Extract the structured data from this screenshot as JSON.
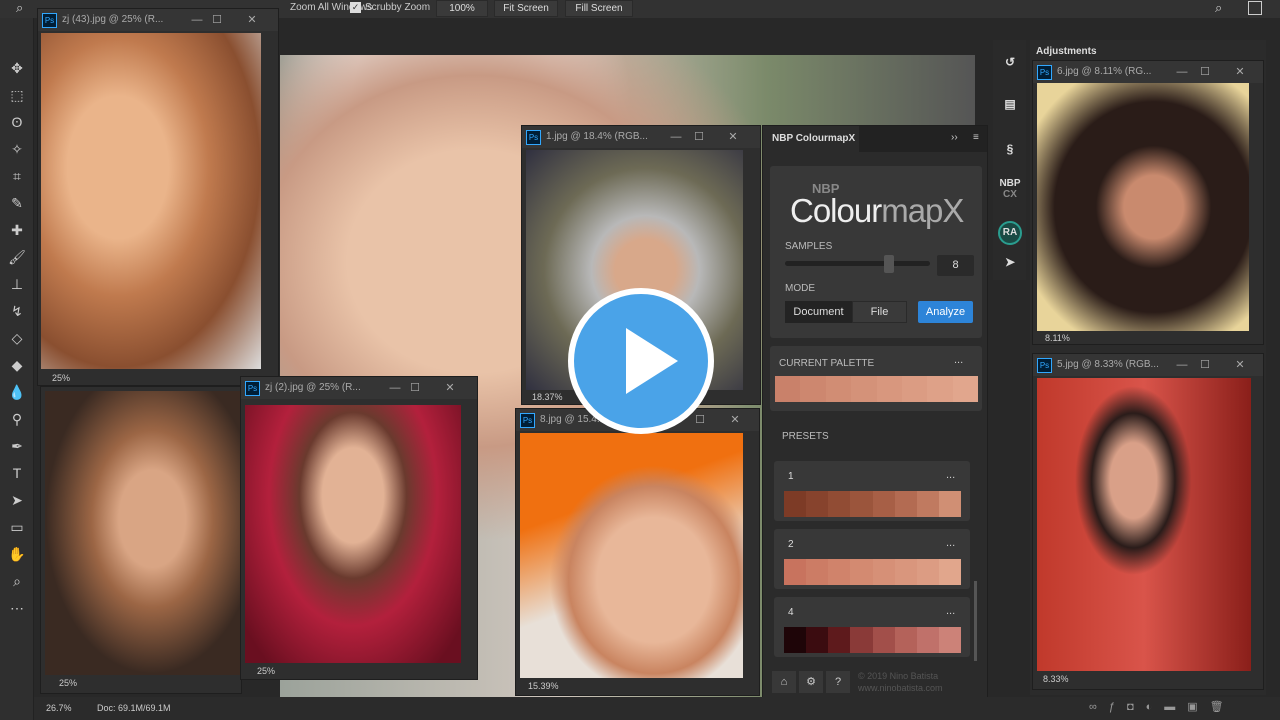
{
  "options_bar": {
    "zoom_all_windows": "Zoom All Windows",
    "scrubby_zoom": "Scrubby Zoom",
    "scrubby_checked": true,
    "btn_100": "100%",
    "fit_screen": "Fit Screen",
    "fill_screen": "Fill Screen"
  },
  "tools": [
    "move",
    "marquee",
    "lasso",
    "magic-wand",
    "crop",
    "eyedropper",
    "healing",
    "brush",
    "stamp",
    "history-brush",
    "eraser",
    "paint-bucket",
    "blur",
    "dodge",
    "pen",
    "type",
    "path-select",
    "rectangle",
    "hand",
    "zoom",
    "more"
  ],
  "windows": {
    "w1": {
      "title": "zj (43).jpg @ 25% (R...",
      "zoom": "25%"
    },
    "w2": {
      "zoom": "25%"
    },
    "w3": {
      "title": "zj (2).jpg @ 25% (R...",
      "zoom": "25%"
    },
    "w4": {
      "title": "1.jpg @ 18.4% (RGB...",
      "zoom": "18.37%"
    },
    "w5": {
      "title": "8.jpg @ 15.4...",
      "zoom": "15.39%"
    },
    "w6": {
      "title": "6.jpg @ 8.11% (RG...",
      "zoom": "8.11%"
    },
    "w7": {
      "title": "5.jpg @ 8.33% (RGB...",
      "zoom": "8.33%"
    }
  },
  "nbp": {
    "tab": "NBP ColourmapX",
    "logo_top": "NBP",
    "logo_main": "Colour",
    "logo_accent": "mapX",
    "samples_label": "SAMPLES",
    "samples_value": "8",
    "samples_fraction": 0.72,
    "mode_label": "MODE",
    "mode_document": "Document",
    "mode_file": "File",
    "analyze": "Analyze",
    "current_palette": "CURRENT PALETTE",
    "current_colors": [
      "#c9816a",
      "#cd876f",
      "#d18d74",
      "#d49279",
      "#d8977e",
      "#db9c83",
      "#dea188",
      "#e1a68d"
    ],
    "presets_label": "PRESETS",
    "presets": [
      {
        "name": "1",
        "colors": [
          "#7d3b26",
          "#87432d",
          "#914c34",
          "#9b553c",
          "#a75f46",
          "#b36b52",
          "#c07a60",
          "#d08f74"
        ]
      },
      {
        "name": "2",
        "colors": [
          "#c8735e",
          "#cc7c65",
          "#d0836b",
          "#d38a71",
          "#d69077",
          "#d9967d",
          "#dc9c83",
          "#e1a68c"
        ]
      },
      {
        "name": "4",
        "colors": [
          "#1e0508",
          "#3b0c10",
          "#5e1a1c",
          "#8a3a38",
          "#a24f4a",
          "#b4625a",
          "#c0716a",
          "#cc8278"
        ]
      }
    ],
    "footer_copyright": "© 2019 Nino Batista",
    "footer_url": "www.ninobatista.com",
    "more": "..."
  },
  "right_panel": {
    "adjustments": "Adjustments",
    "nbp_icon_top": "NBP",
    "nbp_icon_bottom": "CX",
    "ra": "RA"
  },
  "status": {
    "zoom": "26.7%",
    "doc": "Doc: 69.1M/69.1M"
  },
  "colors": {
    "accent": "#2d84d8",
    "play": "#4aa3e8"
  }
}
